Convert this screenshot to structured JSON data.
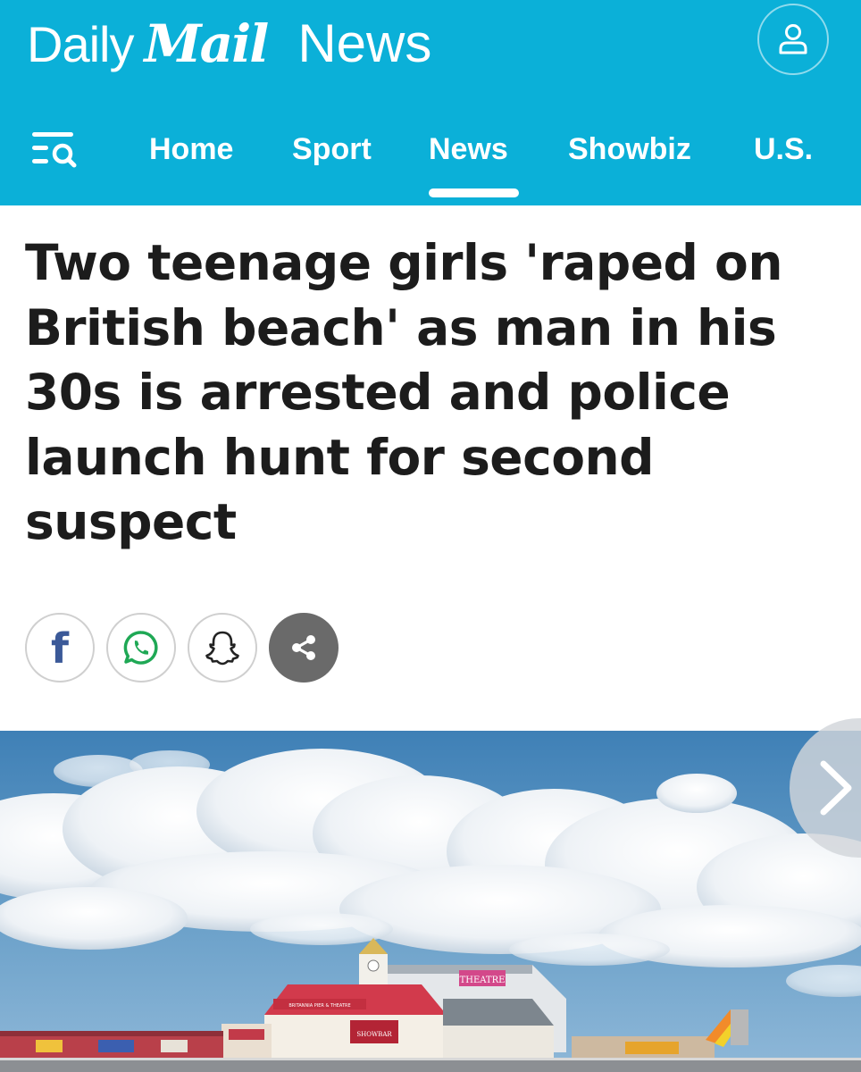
{
  "header": {
    "brand_daily": "Daily",
    "brand_mail": "Mail",
    "brand_section": "News",
    "nav": [
      {
        "label": "Home",
        "active": false
      },
      {
        "label": "Sport",
        "active": false
      },
      {
        "label": "News",
        "active": true
      },
      {
        "label": "Showbiz",
        "active": false
      },
      {
        "label": "U.S.",
        "active": false
      }
    ]
  },
  "article": {
    "headline": "Two teenage girls 'raped on British beach' as man in his 30s is arrested and police launch hunt for second suspect",
    "hero_image": {
      "pier_signs": [
        "THEATRE",
        "BRITANNIA PIER & THEATRE",
        "SHOWBAR"
      ]
    }
  },
  "share": {
    "facebook_glyph": "f",
    "buttons": [
      "facebook-icon",
      "whatsapp-icon",
      "snapchat-icon",
      "share-icon"
    ]
  },
  "colors": {
    "header_bg": "#0bb0d8",
    "headline": "#1c1c1c",
    "facebook_blue": "#3b5998",
    "whatsapp_green": "#1fa855",
    "share_gray": "#6a6a6a"
  }
}
